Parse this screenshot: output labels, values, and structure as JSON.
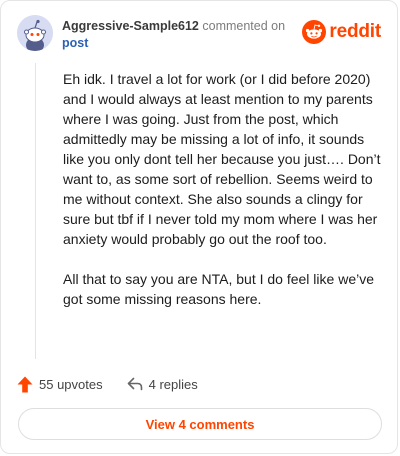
{
  "comment": {
    "username": "Aggressive-Sample612",
    "action_text": "commented on",
    "post_link": "post",
    "paragraphs": [
      "Eh idk. I travel a lot for work (or I did before 2020) and I would always at least mention to my parents where I was going. Just from the post, which admittedly may be missing a lot of info, it sounds like you only dont tell her because you just…. Don’t want to, as some sort of rebellion. Seems weird to me without context. She also sounds a clingy for sure but tbf if I never told my mom where I was her anxiety would probably go out the roof too.",
      "All that to say you are NTA, but I do feel like we’ve got some missing reasons here."
    ]
  },
  "brand": {
    "name": "reddit",
    "color": "#ff4500"
  },
  "actions": {
    "upvotes": "55 upvotes",
    "replies": "4 replies",
    "view_comments": "View 4 comments"
  },
  "icons": {
    "avatar": "snoo-avatar-icon",
    "logo": "reddit-logo-icon",
    "upvote": "upvote-arrow-icon",
    "reply": "reply-arrow-icon"
  }
}
